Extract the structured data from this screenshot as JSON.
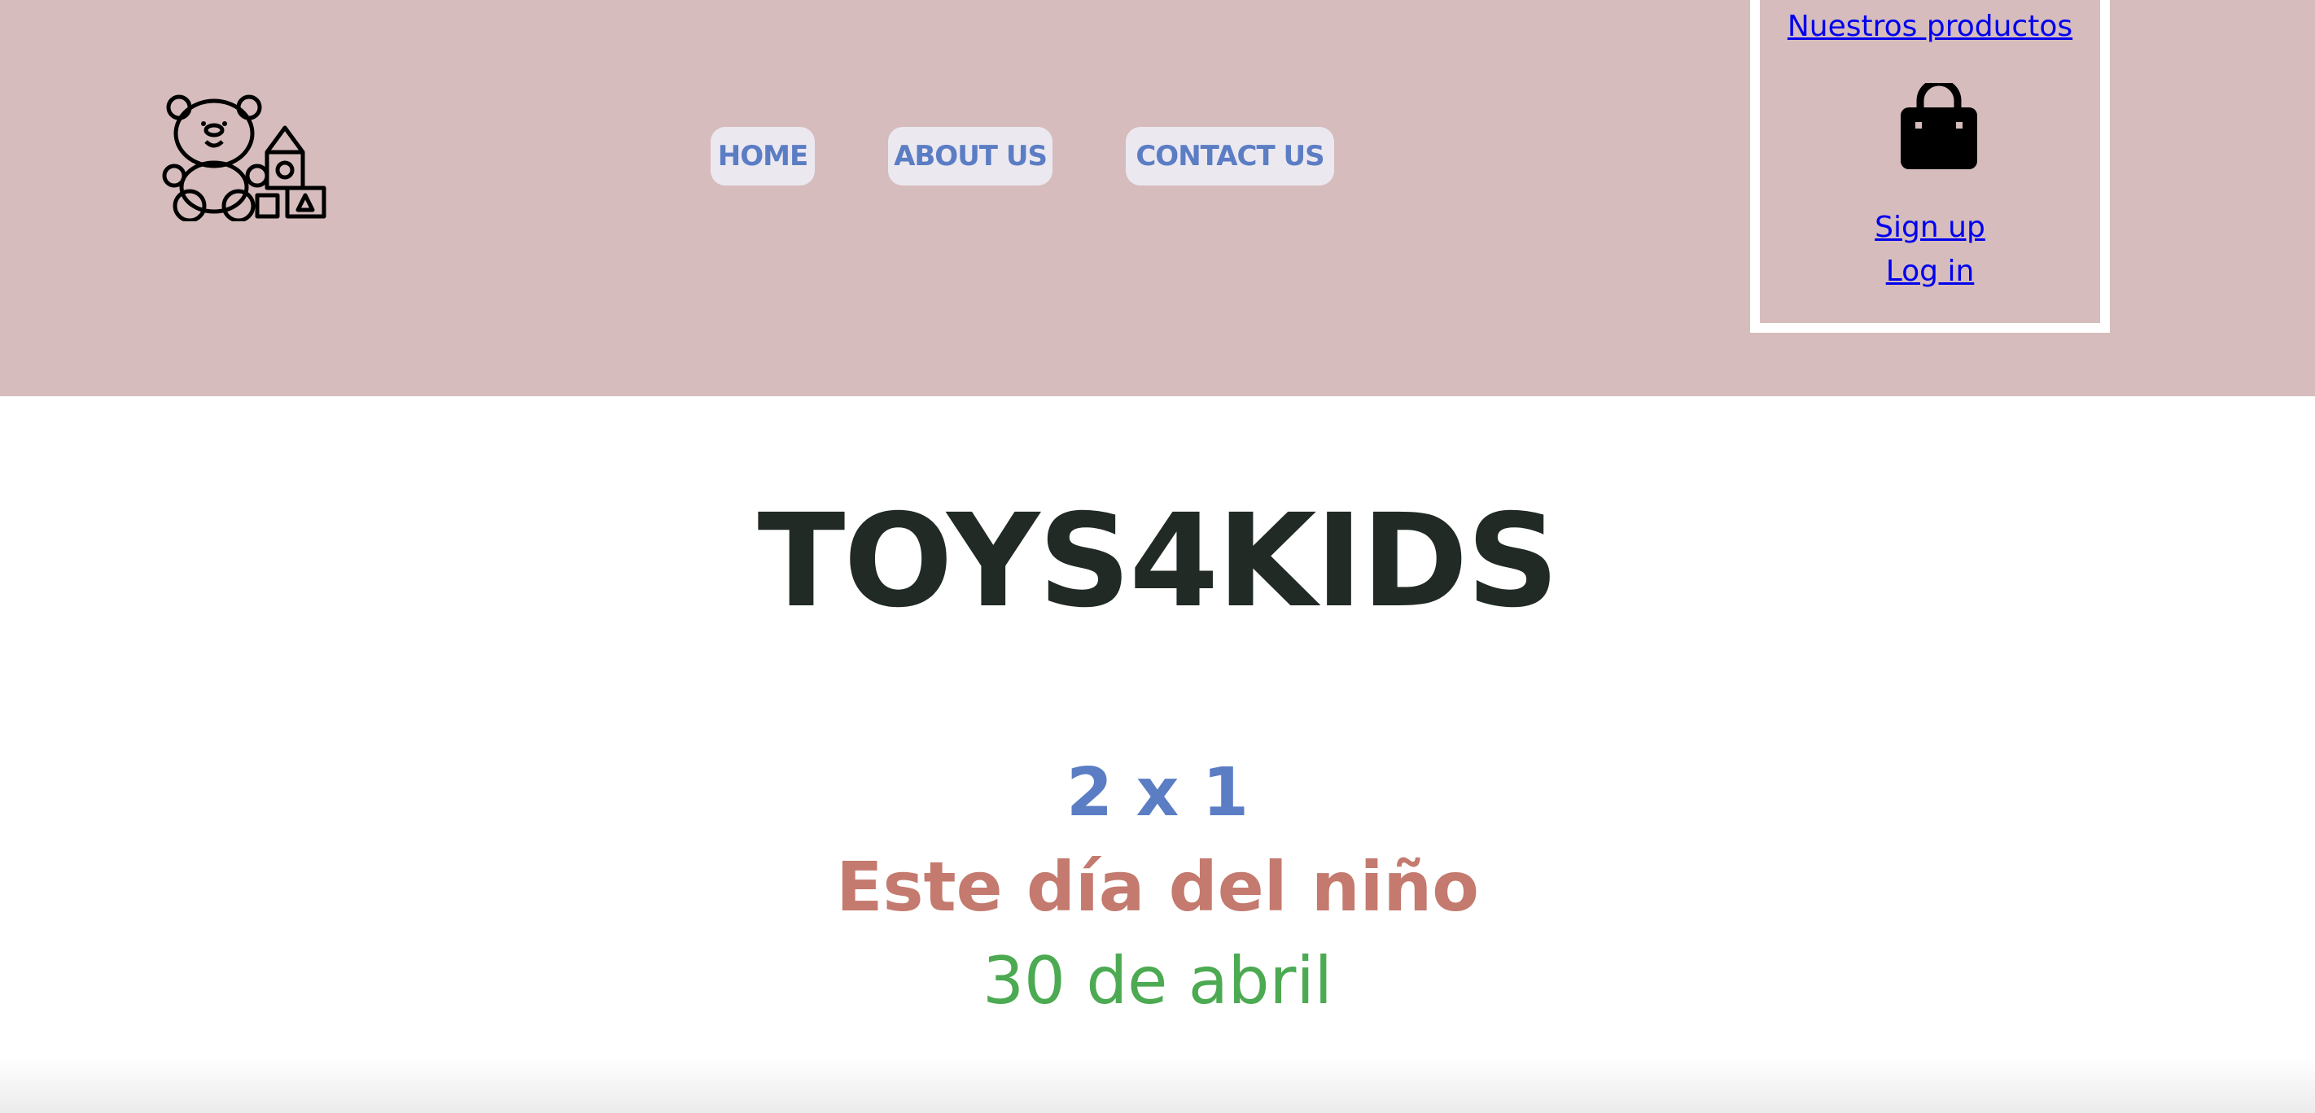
{
  "nav": {
    "home": "HOME",
    "about": "ABOUT US",
    "contact": "CONTACT US"
  },
  "account": {
    "products": "Nuestros productos",
    "signup": "Sign up",
    "login": "Log in"
  },
  "hero": {
    "title": "TOYS4KIDS"
  },
  "promo": {
    "line1": "2 x 1",
    "line2": "Este día del niño",
    "line3": "30 de abril"
  },
  "icons": {
    "logo": "teddy-bear-blocks-icon",
    "cart": "shopping-bag-icon"
  },
  "colors": {
    "header_bg": "#d6bcbc",
    "nav_text": "#5b7dc4",
    "nav_bg": "#ebe8f0",
    "title": "#212a25",
    "promo1": "#5b7dc4",
    "promo2": "#c47a6e",
    "promo3": "#4caa52",
    "link": "#0000ee"
  }
}
